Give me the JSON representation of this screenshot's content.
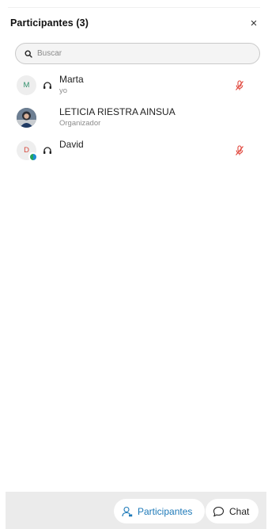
{
  "header": {
    "title": "Participantes (3)",
    "close_symbol": "×"
  },
  "search": {
    "placeholder": "Buscar",
    "value": ""
  },
  "participants": [
    {
      "name": "Marta",
      "subtitle": "yo",
      "avatar_initial": "M",
      "avatar_color": "#2f8f6b",
      "device_icon": "headset-icon",
      "muted": true
    },
    {
      "name": "LETICIA RIESTRA AINSUA",
      "subtitle": "Organizador",
      "avatar_initial": "",
      "avatar_color": "#5a6470",
      "device_icon": "",
      "muted": false
    },
    {
      "name": "David",
      "subtitle": "",
      "avatar_initial": "D",
      "avatar_color": "#d6463a",
      "device_icon": "headset-icon",
      "muted": true
    }
  ],
  "colors": {
    "accent": "#1d79b8",
    "muted_red": "#e0443a"
  },
  "bottom_tabs": {
    "participants_label": "Participantes",
    "chat_label": "Chat"
  }
}
